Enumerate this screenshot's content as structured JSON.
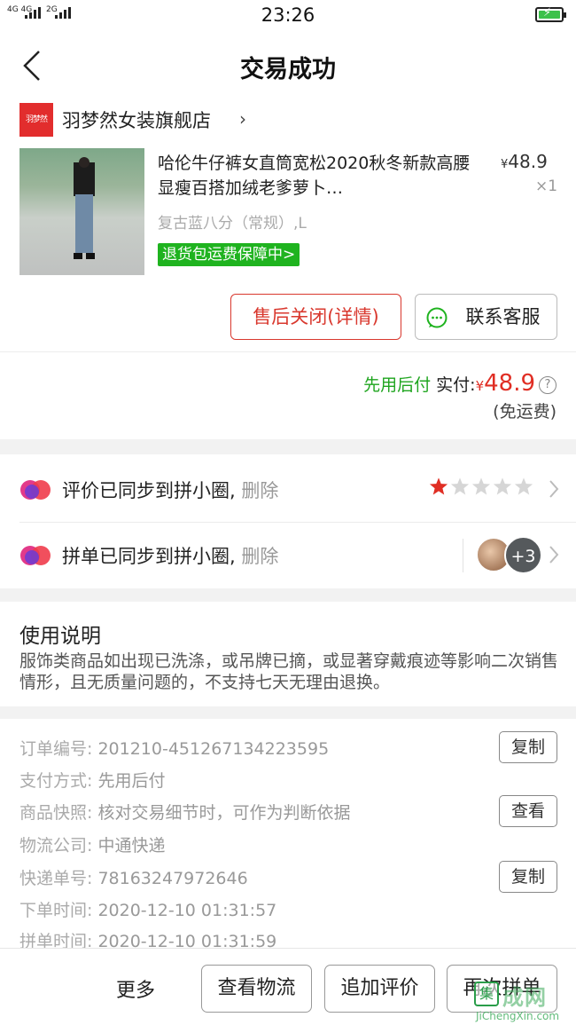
{
  "status_bar": {
    "network_1": "4G 4G",
    "network_2": "2G",
    "time": "23:26"
  },
  "header": {
    "title": "交易成功"
  },
  "shop": {
    "logo_text": "羽梦然",
    "name": "羽梦然女装旗舰店"
  },
  "product": {
    "title": "哈伦牛仔裤女直筒宽松2020秋冬新款高腰显瘦百搭加绒老爹萝卜…",
    "price_symbol": "¥",
    "price": "48.9",
    "quantity": "×1",
    "sku": "复古蓝八分（常规）,L",
    "guarantee": "退货包运费保障中>"
  },
  "actions": {
    "after_sale": "售后关闭(详情)",
    "contact_service": "联系客服"
  },
  "payment": {
    "pay_later": "先用后付",
    "paid_label": "实付:",
    "currency": "¥",
    "amount": "48.9",
    "help_icon": "?",
    "freight": "(免运费)"
  },
  "sync": {
    "review_text": "评价已同步到拼小圈,",
    "review_delete": "删除",
    "review_rating": 1,
    "review_max_rating": 5,
    "group_text": "拼单已同步到拼小圈,",
    "group_delete": "删除",
    "group_more": "+3"
  },
  "usage": {
    "title": "使用说明",
    "text": "服饰类商品如出现已洗涤，或吊牌已摘，或显著穿戴痕迹等影响二次销售情形，且无质量问题的，不支持七天无理由退换。"
  },
  "order_info": [
    {
      "label": "订单编号:",
      "value": "201210-451267134223595",
      "button": "复制"
    },
    {
      "label": "支付方式:",
      "value": "先用后付"
    },
    {
      "label": "商品快照:",
      "value": "核对交易细节时，可作为判断依据",
      "button": "查看"
    },
    {
      "label": "物流公司:",
      "value": "中通快递"
    },
    {
      "label": "快递单号:",
      "value": "78163247972646",
      "button": "复制"
    },
    {
      "label": "下单时间:",
      "value": "2020-12-10 01:31:57"
    },
    {
      "label": "拼单时间:",
      "value": "2020-12-10 01:31:59"
    }
  ],
  "bottom_bar": {
    "more": "更多",
    "logistics": "查看物流",
    "add_review": "追加评价",
    "rebuy": "再次拼单"
  },
  "watermark": {
    "logo_char": "集",
    "text": "成网",
    "url": "JiChengXin.com"
  },
  "colors": {
    "accent_red": "#e02e24",
    "green": "#1fb31f",
    "star_active": "#e02e24",
    "star_inactive": "#d6d6d6"
  }
}
